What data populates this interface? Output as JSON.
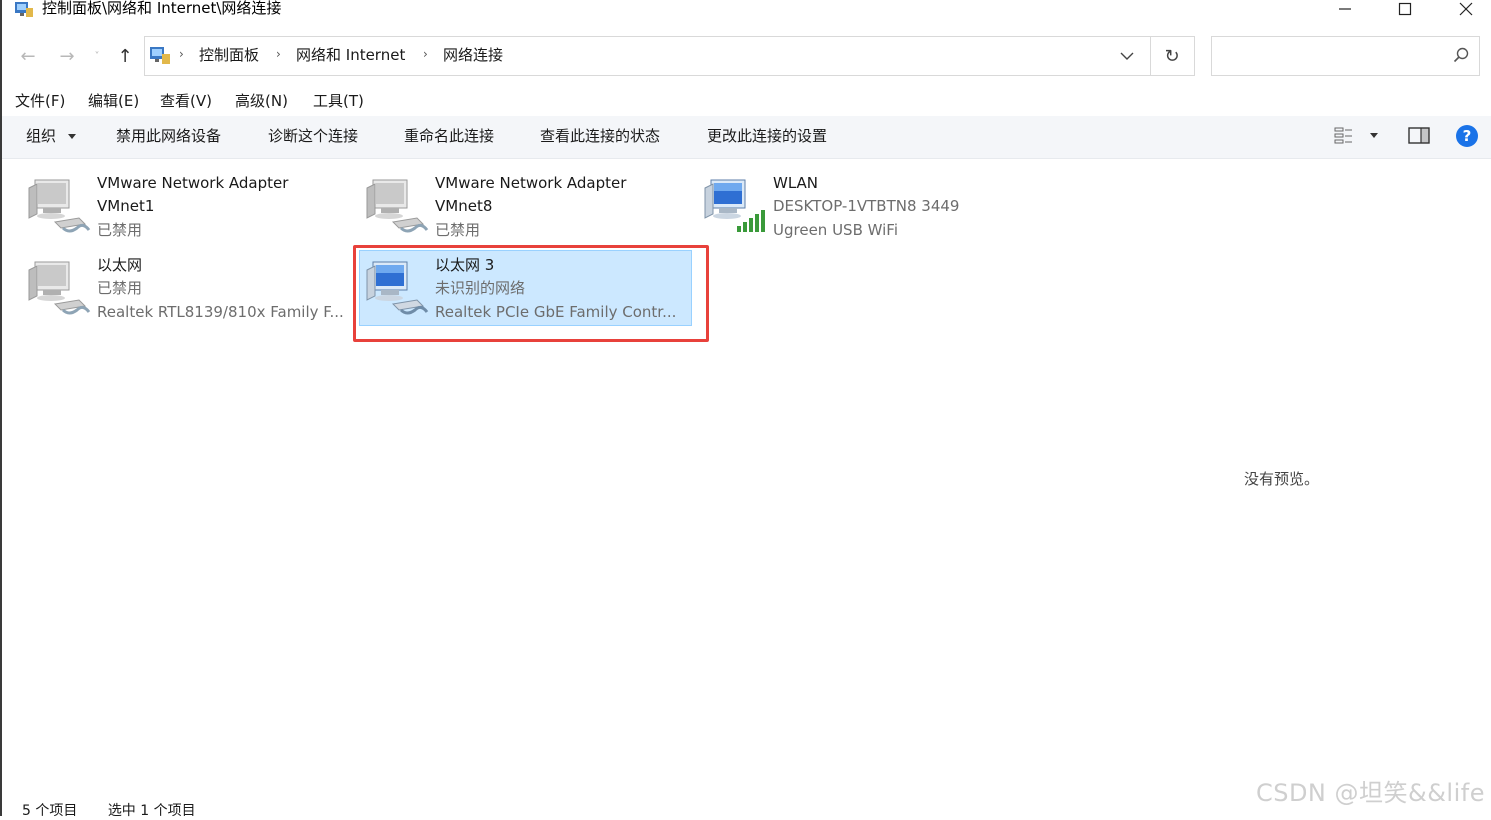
{
  "window": {
    "title": "控制面板\\网络和 Internet\\网络连接"
  },
  "address": {
    "crumbs": [
      "控制面板",
      "网络和 Internet",
      "网络连接"
    ],
    "search_placeholder": ""
  },
  "menu": [
    "文件(F)",
    "编辑(E)",
    "查看(V)",
    "高级(N)",
    "工具(T)"
  ],
  "commands": [
    "组织",
    "禁用此网络设备",
    "诊断这个连接",
    "重命名此连接",
    "查看此连接的状态",
    "更改此连接的设置"
  ],
  "items": [
    {
      "name": "VMware Network Adapter",
      "line2": "VMnet1",
      "line3": "已禁用"
    },
    {
      "name": "VMware Network Adapter",
      "line2": "VMnet8",
      "line3": "已禁用"
    },
    {
      "name": "WLAN",
      "line2": "DESKTOP-1VTBTN8 3449",
      "line3": "Ugreen USB WiFi"
    },
    {
      "name": "以太网",
      "line2": "已禁用",
      "line3": "Realtek RTL8139/810x Family F..."
    },
    {
      "name": "以太网 3",
      "line2": "未识别的网络",
      "line3": "Realtek PCIe GbE Family Contr...",
      "selected": true
    }
  ],
  "preview": {
    "text": "没有预览。"
  },
  "status": {
    "count": "5 个项目",
    "selected": "选中 1 个项目"
  },
  "watermark": "CSDN @坦笑&&life",
  "colors": {
    "selection": "#cce8ff",
    "highlight_box": "#e8413b",
    "help": "#1a73e8"
  }
}
